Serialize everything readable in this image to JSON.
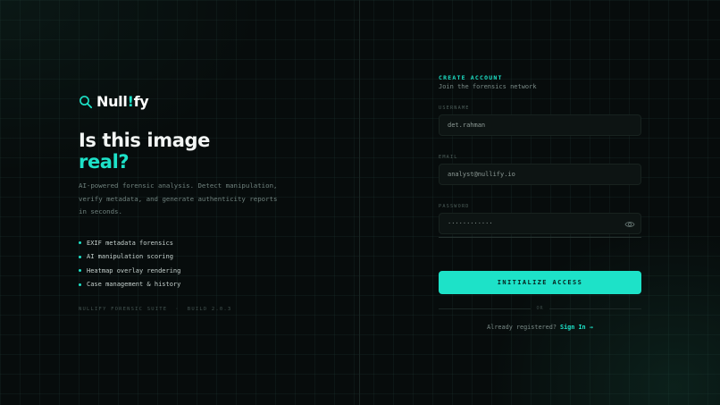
{
  "brand": {
    "icon": "magnifier-icon",
    "name_part1": "Null",
    "name_accent": "!",
    "name_part2": "fy"
  },
  "hero": {
    "headline_line1": "Is this image",
    "headline_line2": "real?",
    "tagline": "AI-powered forensic analysis. Detect manipulation, verify metadata, and generate authenticity reports in seconds."
  },
  "features": [
    "EXIF metadata forensics",
    "AI manipulation scoring",
    "Heatmap overlay rendering",
    "Case management & history"
  ],
  "footnote": "NULLIFY FORENSIC SUITE  ·  BUILD 2.0.3",
  "form": {
    "kicker": "CREATE ACCOUNT",
    "subtitle": "Join the forensics network",
    "username_label": "USERNAME",
    "username_value": "det.rahman",
    "email_label": "EMAIL",
    "email_value": "analyst@nullify.io",
    "password_label": "PASSWORD",
    "password_value": "············",
    "password_toggle_icon": "eye-icon",
    "submit_label": "INITIALIZE ACCESS",
    "divider_label": "OR",
    "signin_prompt": "Already registered?",
    "signin_link": "Sign In →"
  },
  "colors": {
    "accent": "#1de2c8",
    "background": "#070c0c",
    "field": "#0d1413"
  }
}
